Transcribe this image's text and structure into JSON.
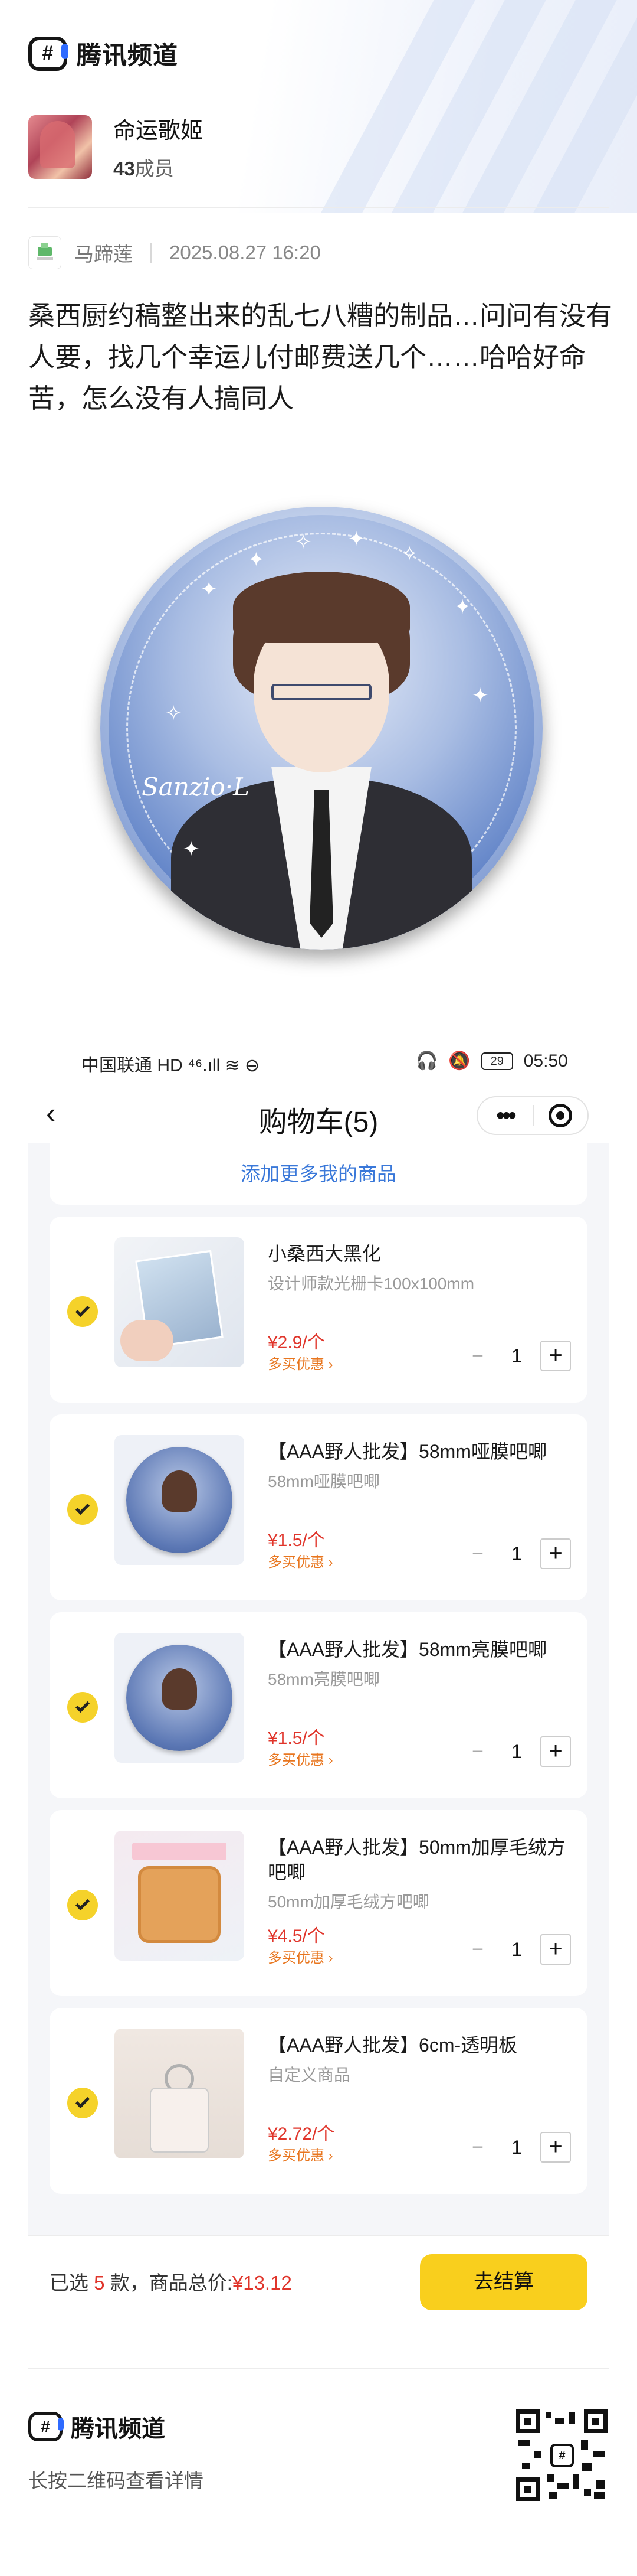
{
  "brand": {
    "logo_glyph": "#",
    "name": "腾讯频道"
  },
  "channel": {
    "name": "命运歌姬",
    "member_count": "43",
    "member_label": "成员"
  },
  "post": {
    "author": "马蹄莲",
    "time": "2025.08.27 16:20",
    "body": "桑西厨约稿整出来的乱七八糟的制品…问问有没有人要，找几个幸运儿付邮费送几个……哈哈好命苦，怎么没有人搞同人",
    "badge_signature": "Sanzio·L"
  },
  "screenshot": {
    "status_left": "中国联通 HD ⁴⁶.ıll ≋ ⊖",
    "status_battery": "29",
    "status_time": "05:50",
    "nav_title": "购物车(5)",
    "back_glyph": "‹",
    "more_glyph": "•••",
    "add_more": "添加更多我的商品",
    "items": [
      {
        "title": "小桑西大黑化",
        "sub": "设计师款光栅卡100x100mm",
        "price": "¥2.9",
        "unit": "/个",
        "promo": "多买优惠 ›",
        "qty": "1"
      },
      {
        "title": "【AAA野人批发】58mm哑膜吧唧",
        "sub": "58mm哑膜吧唧",
        "price": "¥1.5",
        "unit": "/个",
        "promo": "多买优惠 ›",
        "qty": "1"
      },
      {
        "title": "【AAA野人批发】58mm亮膜吧唧",
        "sub": "58mm亮膜吧唧",
        "price": "¥1.5",
        "unit": "/个",
        "promo": "多买优惠 ›",
        "qty": "1"
      },
      {
        "title": "【AAA野人批发】50mm加厚毛绒方吧唧",
        "sub": "50mm加厚毛绒方吧唧",
        "price": "¥4.5",
        "unit": "/个",
        "promo": "多买优惠 ›",
        "qty": "1"
      },
      {
        "title": "【AAA野人批发】6cm-透明板",
        "sub": "自定义商品",
        "price": "¥2.72",
        "unit": "/个",
        "promo": "多买优惠 ›",
        "qty": "1"
      }
    ],
    "minus_glyph": "−",
    "plus_glyph": "+",
    "summary_prefix": "已选",
    "summary_count": "5",
    "summary_mid": "款，商品总价:",
    "summary_total": "¥13.12",
    "checkout_label": "去结算"
  },
  "footer": {
    "brand": "腾讯频道",
    "hint": "长按二维码查看详情"
  },
  "colors": {
    "accent_yellow": "#f9cf1d",
    "price_red": "#e0352b",
    "link_blue": "#3a78d9",
    "brand_blue": "#2f6bff"
  }
}
